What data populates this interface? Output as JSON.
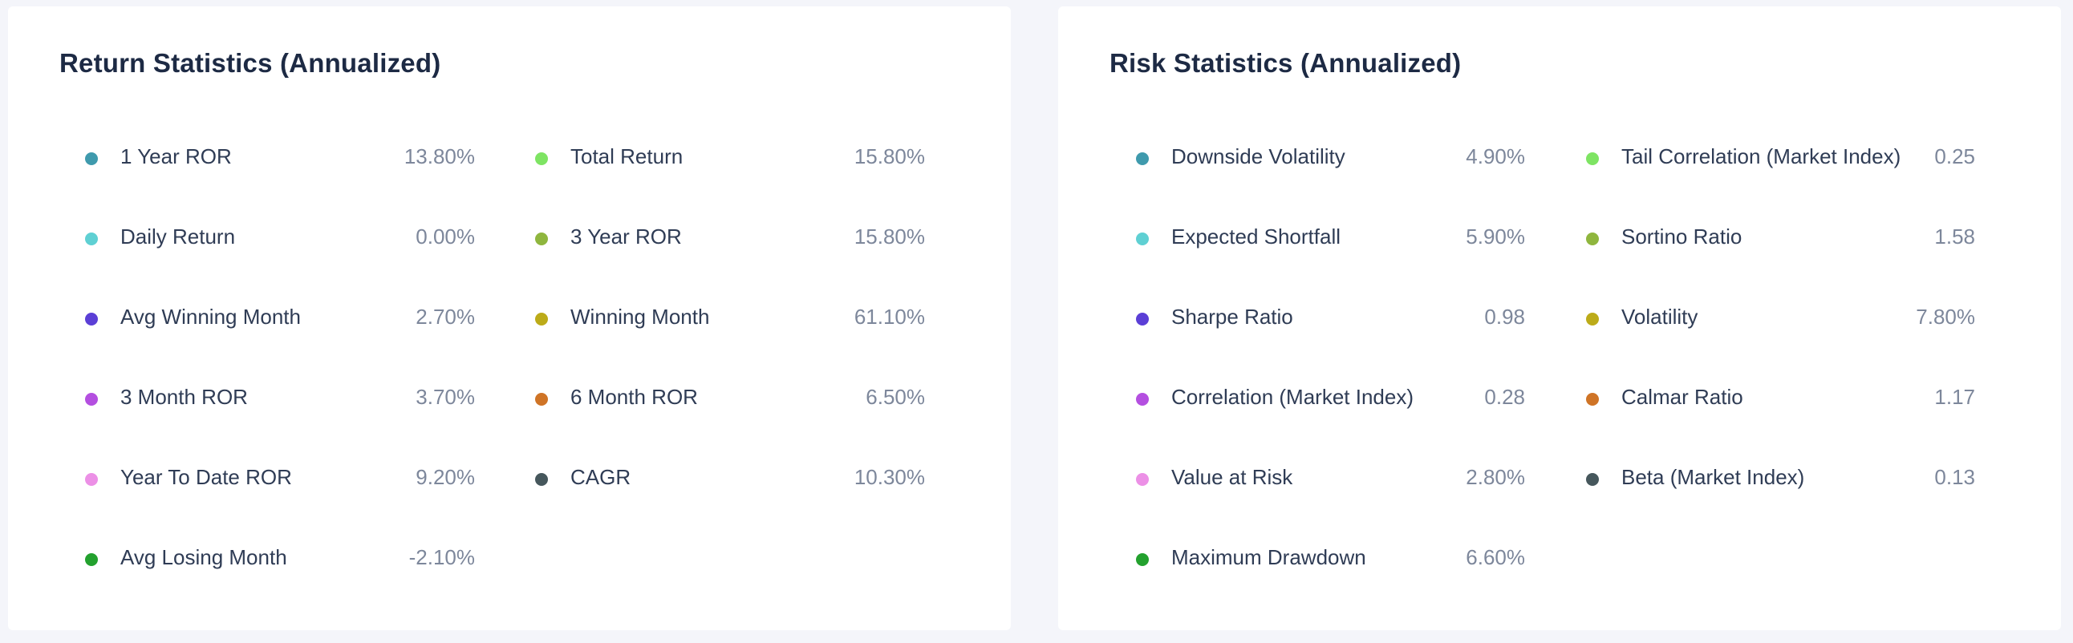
{
  "return_card": {
    "title": "Return Statistics (Annualized)",
    "columns": [
      [
        {
          "label": "1 Year ROR",
          "value": "13.80%",
          "color": "#3f9aad"
        },
        {
          "label": "Daily Return",
          "value": "0.00%",
          "color": "#5fd0d3"
        },
        {
          "label": "Avg Winning Month",
          "value": "2.70%",
          "color": "#5b3fd6"
        },
        {
          "label": "3 Month ROR",
          "value": "3.70%",
          "color": "#b44fe0"
        },
        {
          "label": "Year To Date ROR",
          "value": "9.20%",
          "color": "#ec90e6"
        },
        {
          "label": "Avg Losing Month",
          "value": "-2.10%",
          "color": "#23a12e"
        }
      ],
      [
        {
          "label": "Total Return",
          "value": "15.80%",
          "color": "#7ee463"
        },
        {
          "label": "3 Year ROR",
          "value": "15.80%",
          "color": "#8fb63e"
        },
        {
          "label": "Winning Month",
          "value": "61.10%",
          "color": "#bcab19"
        },
        {
          "label": "6 Month ROR",
          "value": "6.50%",
          "color": "#cf7426"
        },
        {
          "label": "CAGR",
          "value": "10.30%",
          "color": "#46575c"
        }
      ]
    ]
  },
  "risk_card": {
    "title": "Risk Statistics (Annualized)",
    "columns": [
      [
        {
          "label": "Downside Volatility",
          "value": "4.90%",
          "color": "#3f9aad"
        },
        {
          "label": "Expected Shortfall",
          "value": "5.90%",
          "color": "#5fd0d3"
        },
        {
          "label": "Sharpe Ratio",
          "value": "0.98",
          "color": "#5b3fd6"
        },
        {
          "label": "Correlation (Market Index)",
          "value": "0.28",
          "color": "#b44fe0"
        },
        {
          "label": "Value at Risk",
          "value": "2.80%",
          "color": "#ec90e6"
        },
        {
          "label": "Maximum Drawdown",
          "value": "6.60%",
          "color": "#23a12e"
        }
      ],
      [
        {
          "label": "Tail Correlation (Market Index)",
          "value": "0.25",
          "color": "#7ee463"
        },
        {
          "label": "Sortino Ratio",
          "value": "1.58",
          "color": "#8fb63e"
        },
        {
          "label": "Volatility",
          "value": "7.80%",
          "color": "#bcab19"
        },
        {
          "label": "Calmar Ratio",
          "value": "1.17",
          "color": "#cf7426"
        },
        {
          "label": "Beta (Market Index)",
          "value": "0.13",
          "color": "#46575c"
        }
      ]
    ]
  }
}
